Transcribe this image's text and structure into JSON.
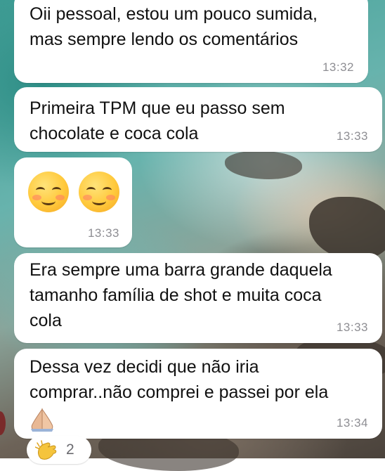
{
  "messages": [
    {
      "text": "Oii pessoal, estou um pouco sumida,\nmas sempre lendo os comentários",
      "time": "13:32"
    },
    {
      "text": "Primeira TPM que eu passo sem\nchocolate e coca cola",
      "time": "13:33"
    },
    {
      "emojis": [
        "smiling-face-icon",
        "smiling-face-icon"
      ],
      "time": "13:33"
    },
    {
      "text": "Era sempre uma barra grande daquela\ntamanho família de shot e muita coca\ncola",
      "time": "13:33"
    },
    {
      "text": "Dessa vez decidi que não iria\ncomprar..não comprei e passei por ela",
      "emoji": "folded-hands-icon",
      "time": "13:34"
    }
  ],
  "reaction": {
    "emoji": "clapping-hands-icon",
    "count": "2"
  },
  "colors": {
    "bubble": "#ffffff",
    "time": "#8e8e93",
    "text": "#111111"
  }
}
